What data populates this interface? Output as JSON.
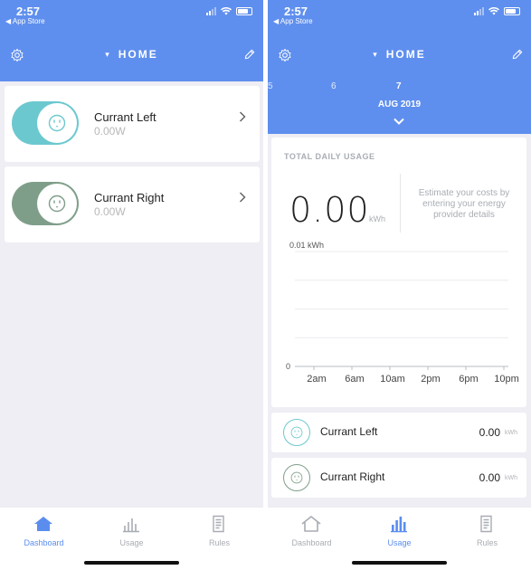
{
  "colors": {
    "header": "#5f8fee",
    "accent": "#5b8def",
    "toggle_left": "#6cc8cf",
    "toggle_right": "#7f9e89",
    "muted": "#a9adb4"
  },
  "status": {
    "time": "2:57",
    "back": "◀ App Store"
  },
  "header": {
    "title": "HOME"
  },
  "dashboard": {
    "devices": [
      {
        "name": "Currant Left",
        "power": "0.00W",
        "on": true
      },
      {
        "name": "Currant Right",
        "power": "0.00W",
        "on": true
      }
    ]
  },
  "usage": {
    "dates": [
      "5",
      "6",
      "7"
    ],
    "month": "AUG 2019",
    "title": "TOTAL DAILY USAGE",
    "total_value": "0.00",
    "total_unit": "kWh",
    "estimate_text": "Estimate your costs by entering your energy provider details",
    "devices": [
      {
        "name": "Currant Left",
        "value": "0.00",
        "unit": "kWh"
      },
      {
        "name": "Currant Right",
        "value": "0.00",
        "unit": "kWh"
      }
    ]
  },
  "chart_data": {
    "type": "bar",
    "ylabel": "",
    "xlabel": "",
    "y_top_label": "0.01 kWh",
    "y_zero_label": "0",
    "ylim": [
      0,
      0.01
    ],
    "categories": [
      "2am",
      "6am",
      "10am",
      "2pm",
      "6pm",
      "10pm"
    ],
    "values": [
      0,
      0,
      0,
      0,
      0,
      0
    ],
    "grid": true
  },
  "tabs": [
    {
      "label": "Dashboard",
      "icon": "house-icon"
    },
    {
      "label": "Usage",
      "icon": "bar-chart-icon"
    },
    {
      "label": "Rules",
      "icon": "document-icon"
    }
  ]
}
